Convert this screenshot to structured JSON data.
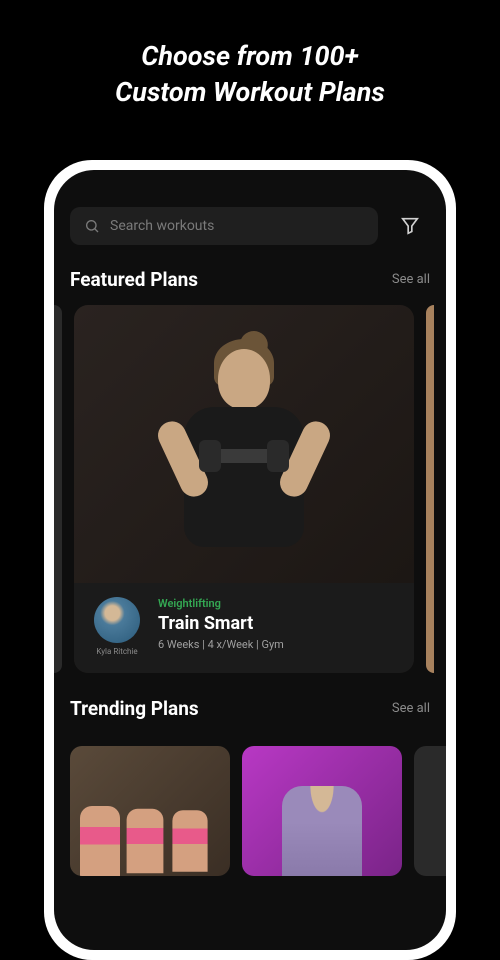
{
  "hero": {
    "line1": "Choose from 100+",
    "line2": "Custom Workout Plans"
  },
  "search": {
    "placeholder": "Search workouts"
  },
  "sections": {
    "featured": {
      "title": "Featured Plans",
      "see_all": "See all"
    },
    "trending": {
      "title": "Trending Plans",
      "see_all": "See all"
    }
  },
  "featured_plan": {
    "tag": "Weightlifting",
    "tag_color": "#34a853",
    "name": "Train Smart",
    "meta": "6 Weeks | 4 x/Week | Gym",
    "trainer": "Kyla Ritchie"
  }
}
